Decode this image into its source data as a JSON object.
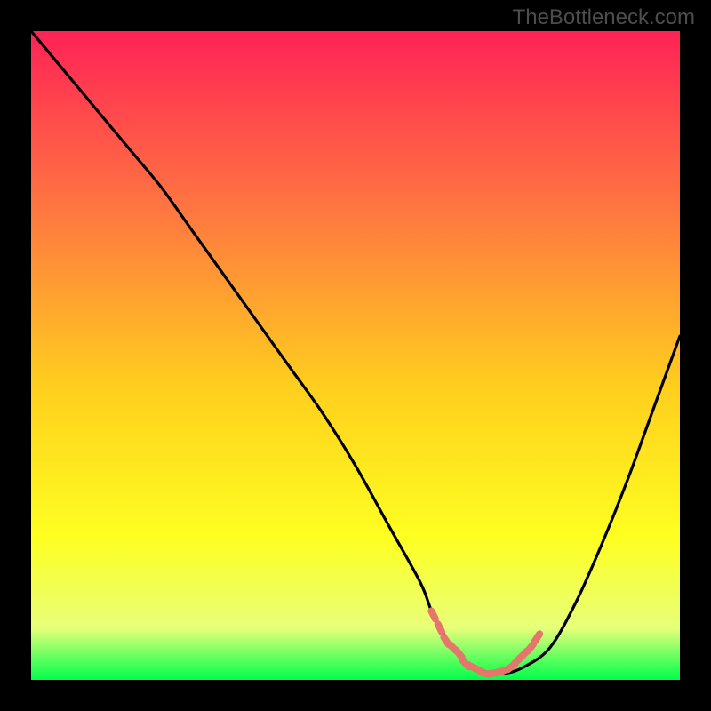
{
  "watermark": "TheBottleneck.com",
  "colors": {
    "background": "#000000",
    "watermark_text": "#4d4d4d",
    "curve_stroke": "#000000",
    "dash_stroke": "#e5766b",
    "gradient_top": "#ff2256",
    "gradient_mid_upper": "#ff7840",
    "gradient_mid": "#ffcf1e",
    "gradient_mid_lower": "#feff20",
    "gradient_low": "#e8ff7a",
    "gradient_bottom": "#00ff4b"
  },
  "chart_data": {
    "type": "line",
    "title": "",
    "xlabel": "",
    "ylabel": "",
    "xlim": [
      0,
      100
    ],
    "ylim": [
      0,
      100
    ],
    "series": [
      {
        "name": "bottleneck-curve",
        "x": [
          0,
          5,
          10,
          15,
          20,
          25,
          30,
          35,
          40,
          45,
          50,
          55,
          60,
          62,
          65,
          68,
          70,
          73,
          76,
          80,
          84,
          88,
          92,
          96,
          100
        ],
        "values": [
          100,
          94,
          88,
          82,
          76,
          69,
          62,
          55,
          48,
          41,
          33,
          24,
          15,
          10,
          5,
          2,
          1,
          1,
          2,
          5,
          12,
          21,
          31,
          42,
          53
        ]
      }
    ],
    "annotations": [
      {
        "name": "optimal-zone-dashes",
        "style": "short-dash",
        "x": [
          62,
          63,
          64,
          65,
          66,
          67,
          68,
          69,
          70,
          71,
          72,
          73,
          74,
          75,
          76,
          77,
          78
        ],
        "values": [
          10,
          8,
          6,
          5,
          4,
          2.5,
          2,
          1.5,
          1,
          1,
          1.2,
          1.5,
          2,
          3,
          4,
          5,
          6.5
        ]
      }
    ]
  }
}
